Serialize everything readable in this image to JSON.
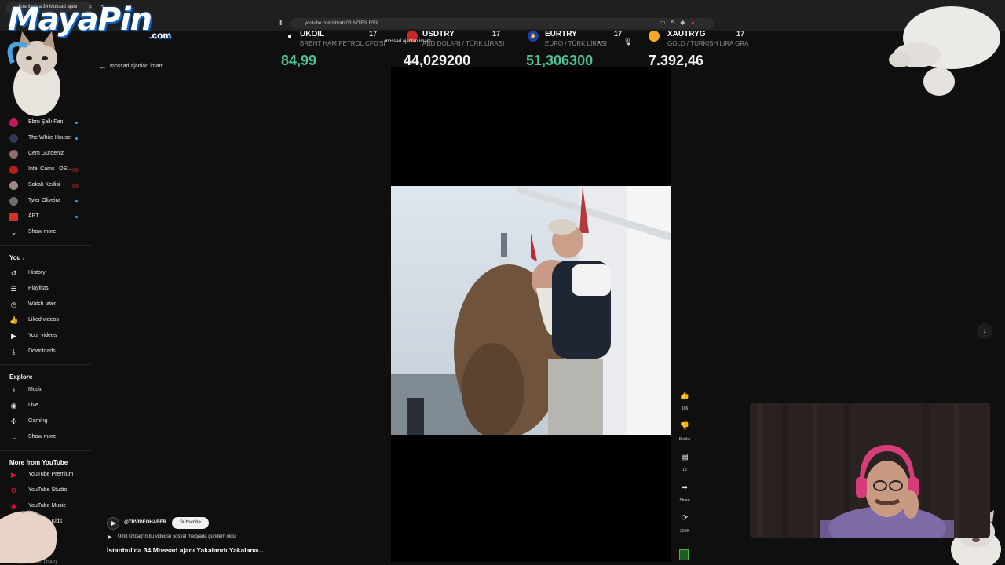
{
  "browser": {
    "tab_title": "İstanbul'da 34 Mossad ajanı",
    "url": "youtube.com/shorts/YLh71EdUYE8"
  },
  "logo": {
    "brand": "MayaPin",
    "suffix": ".com"
  },
  "ticker": [
    {
      "symbol": "UKOIL",
      "desc": "BRENT HAM PETROL CFD'Sİ",
      "value": "84,99",
      "value_color": "#4fc38f",
      "icon": "oil-drop-icon"
    },
    {
      "symbol": "USDTRY",
      "desc": "ABD DOLARI / TÜRK LİRASI",
      "value": "44,029200",
      "value_color": "#f1f1f1",
      "icon": "us-flag-icon"
    },
    {
      "symbol": "EURTRY",
      "desc": "EURO / TÜRK LİRASI",
      "value": "51,306300",
      "value_color": "#4fc38f",
      "icon": "eu-flag-icon"
    },
    {
      "symbol": "XAUTRYG",
      "desc": "GOLD / TURKISH LIRA GRA",
      "value": "7.392,46",
      "value_color": "#f1f1f1",
      "icon": "gold-coin-icon"
    }
  ],
  "header": {
    "search_query": "mossad ajanları imam",
    "query_overlay": "mossad ajanları imam"
  },
  "subscriptions": [
    {
      "label": "Ebru Şallı Fan",
      "avatar_color": "#c2185b",
      "indicator": "dot"
    },
    {
      "label": "The White House",
      "avatar_color": "#2b3b55",
      "indicator": "dot"
    },
    {
      "label": "Cem Gürdeniz",
      "avatar_color": "#8d6e63",
      "indicator": "none"
    },
    {
      "label": "Intel Cams | OSI...",
      "avatar_color": "#b71c1c",
      "indicator": "live"
    },
    {
      "label": "Sokak Kedisi",
      "avatar_color": "#a1887f",
      "indicator": "live"
    },
    {
      "label": "Tyler Oliveira",
      "avatar_color": "#6d6d6d",
      "indicator": "dot"
    },
    {
      "label": "APT",
      "avatar_color": "#d32f2f",
      "indicator": "dot"
    }
  ],
  "subscriptions_more": "Show more",
  "you": {
    "heading": "You",
    "items": [
      {
        "label": "History",
        "icon": "history-icon"
      },
      {
        "label": "Playlists",
        "icon": "playlists-icon"
      },
      {
        "label": "Watch later",
        "icon": "clock-icon"
      },
      {
        "label": "Liked videos",
        "icon": "thumb-up-icon"
      },
      {
        "label": "Your videos",
        "icon": "video-icon"
      },
      {
        "label": "Downloads",
        "icon": "download-icon"
      }
    ]
  },
  "explore": {
    "heading": "Explore",
    "items": [
      {
        "label": "Music",
        "icon": "music-note-icon"
      },
      {
        "label": "Live",
        "icon": "live-icon"
      },
      {
        "label": "Gaming",
        "icon": "gamepad-icon"
      },
      {
        "label": "Show more",
        "icon": "chevron-down-icon"
      }
    ]
  },
  "more_from_youtube": {
    "heading": "More from YouTube",
    "items": [
      {
        "label": "YouTube Premium"
      },
      {
        "label": "YouTube Studio"
      },
      {
        "label": "YouTube Music"
      },
      {
        "label": "YouTube Kids"
      }
    ],
    "footer_item": "Report history"
  },
  "video": {
    "channel": "@TRVIDEOHABER",
    "subscribe_label": "Subscribe",
    "description": "Ümit Özdağ'ın bu videosu sosyal medyada gündem oldu.",
    "title": "İstanbul'da 34 Mossad ajanı Yakalandı.Yakalana..."
  },
  "actions": {
    "likes": "106",
    "dislike_label": "Dislike",
    "comments": "13",
    "share_label": "Share",
    "remix": "358K"
  }
}
